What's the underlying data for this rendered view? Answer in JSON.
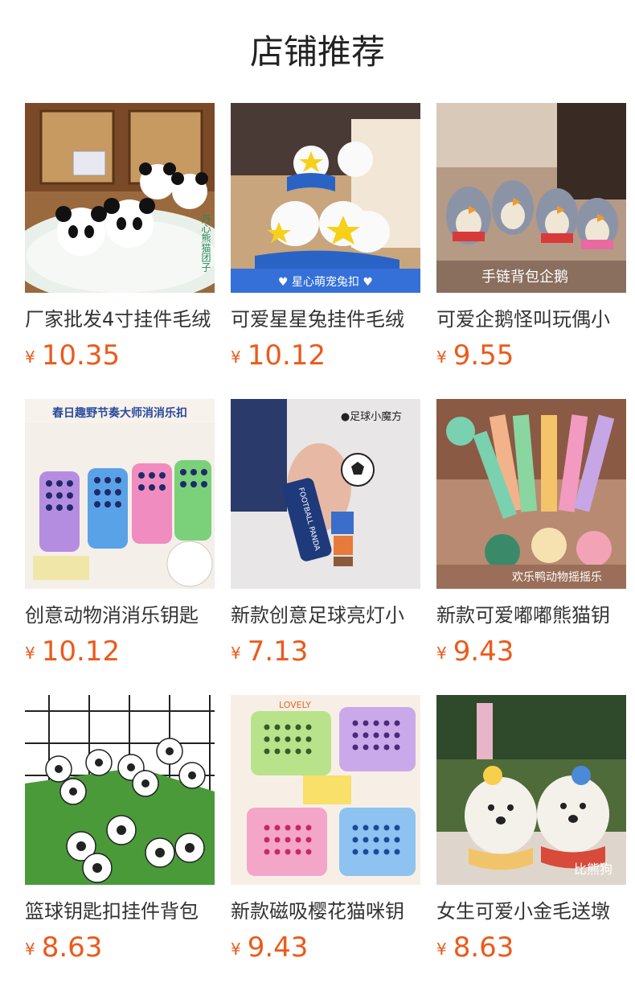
{
  "header": {
    "title": "店铺推荐"
  },
  "colors": {
    "price": "#ec5a1a",
    "text": "#333333",
    "title": "#222222"
  },
  "products": [
    {
      "title": "厂家批发4寸挂件毛绒",
      "currency": "¥",
      "price": "10.35",
      "overlay": "丹心熊猫团子"
    },
    {
      "title": "可爱星星兔挂件毛绒",
      "currency": "¥",
      "price": "10.12",
      "overlay": "♥ 星心萌宠兔扣 ♥"
    },
    {
      "title": "可爱企鹅怪叫玩偶小",
      "currency": "¥",
      "price": "9.55",
      "overlay": "手链背包企鹅"
    },
    {
      "title": "创意动物消消乐钥匙",
      "currency": "¥",
      "price": "10.12",
      "overlay": "春日趣野节奏大师消消乐扣"
    },
    {
      "title": "新款创意足球亮灯小",
      "currency": "¥",
      "price": "7.13",
      "overlay": "●足球小魔方"
    },
    {
      "title": "新款可爱嘟嘟熊猫钥",
      "currency": "¥",
      "price": "9.43",
      "overlay": "欢乐鸭动物摇摇乐"
    },
    {
      "title": "篮球钥匙扣挂件背包",
      "currency": "¥",
      "price": "8.63",
      "overlay": ""
    },
    {
      "title": "新款磁吸樱花猫咪钥",
      "currency": "¥",
      "price": "9.43",
      "overlay": "LOVELY"
    },
    {
      "title": "女生可爱小金毛送墩",
      "currency": "¥",
      "price": "8.63",
      "overlay": "比熊狗"
    }
  ]
}
